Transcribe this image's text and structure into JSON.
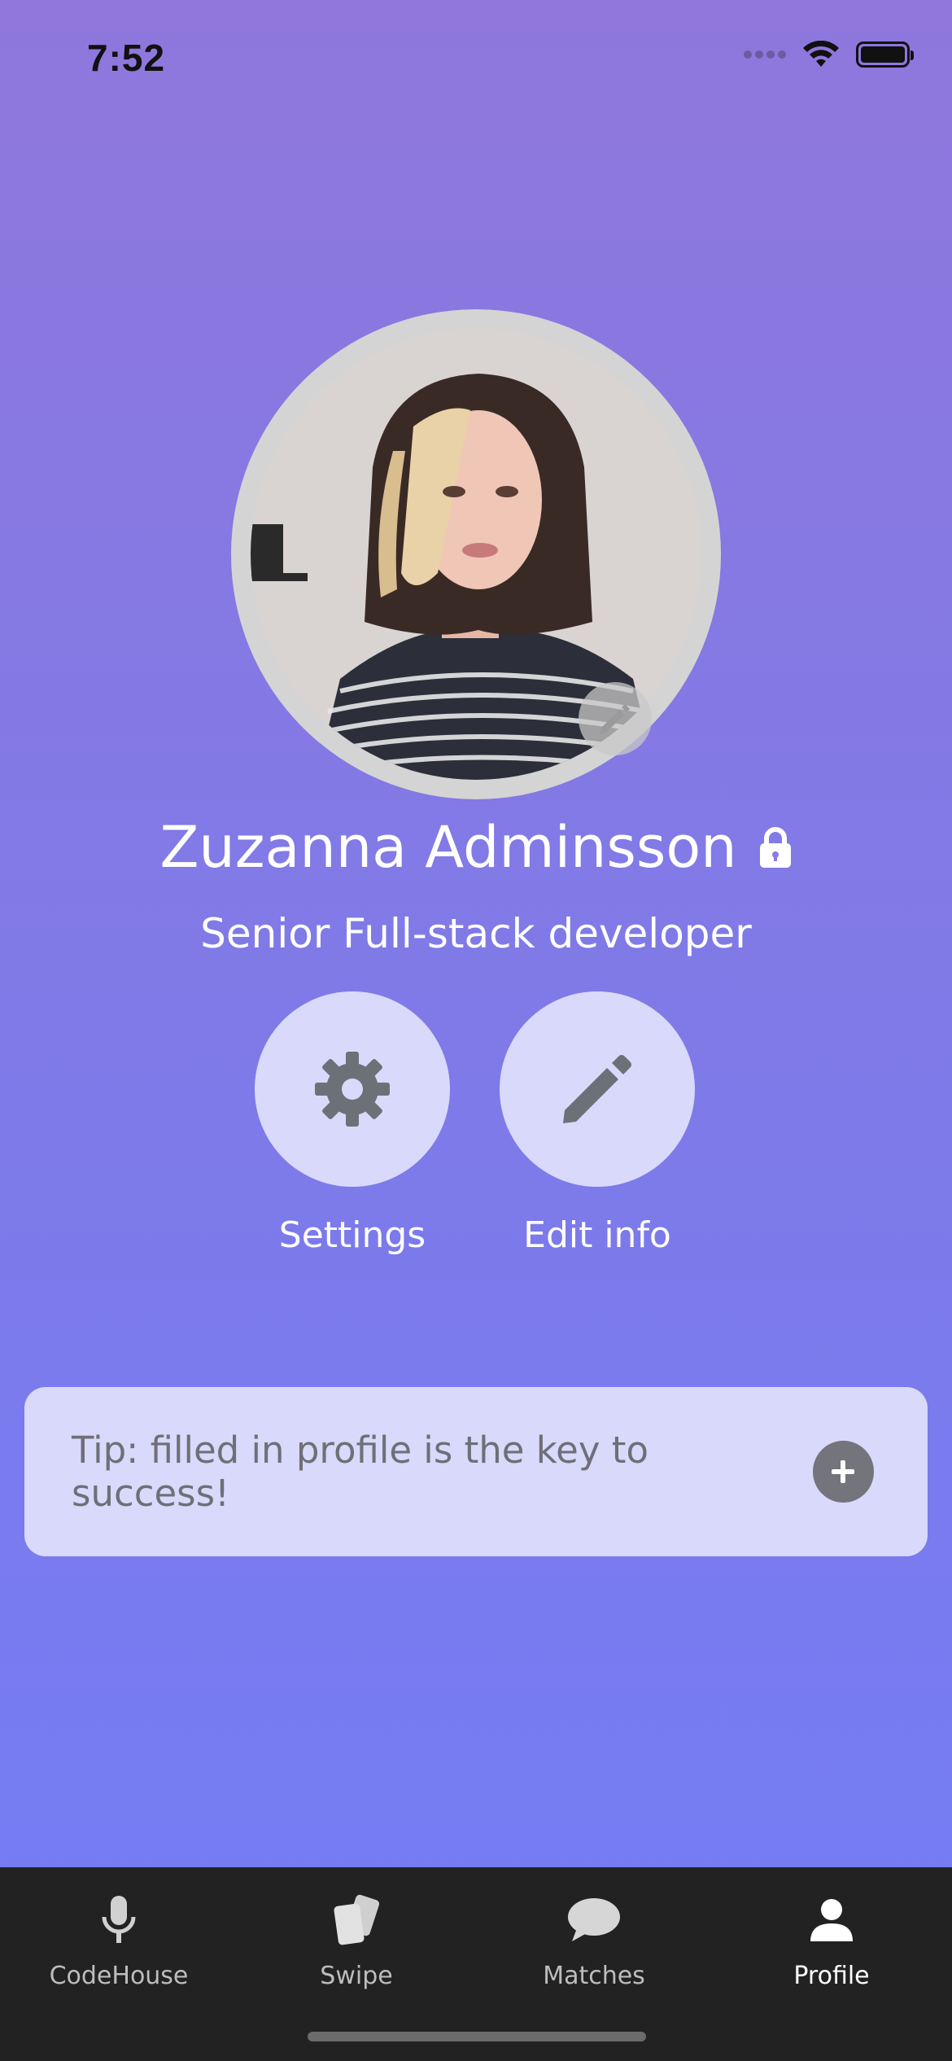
{
  "status_bar": {
    "time": "7:52"
  },
  "profile": {
    "name": "Zuzanna Adminsson",
    "title": "Senior Full-stack developer",
    "avatar_icon": "profile-photo",
    "lock_icon": "lock-icon"
  },
  "actions": [
    {
      "label": "Settings",
      "icon": "gear-icon"
    },
    {
      "label": "Edit info",
      "icon": "pencil-icon"
    }
  ],
  "tip": {
    "text": "Tip: filled in profile is the key to success!",
    "icon": "plus-circle-icon"
  },
  "tabs": [
    {
      "label": "CodeHouse",
      "icon": "microphone-icon",
      "active": false
    },
    {
      "label": "Swipe",
      "icon": "cards-icon",
      "active": false
    },
    {
      "label": "Matches",
      "icon": "chat-bubble-icon",
      "active": false
    },
    {
      "label": "Profile",
      "icon": "person-icon",
      "active": true
    }
  ],
  "colors": {
    "background_top": "#8f77dc",
    "background_bottom": "#737cf6",
    "card": "#d9d9fb",
    "tabbar": "#222222",
    "icon_gray": "#74747c"
  }
}
